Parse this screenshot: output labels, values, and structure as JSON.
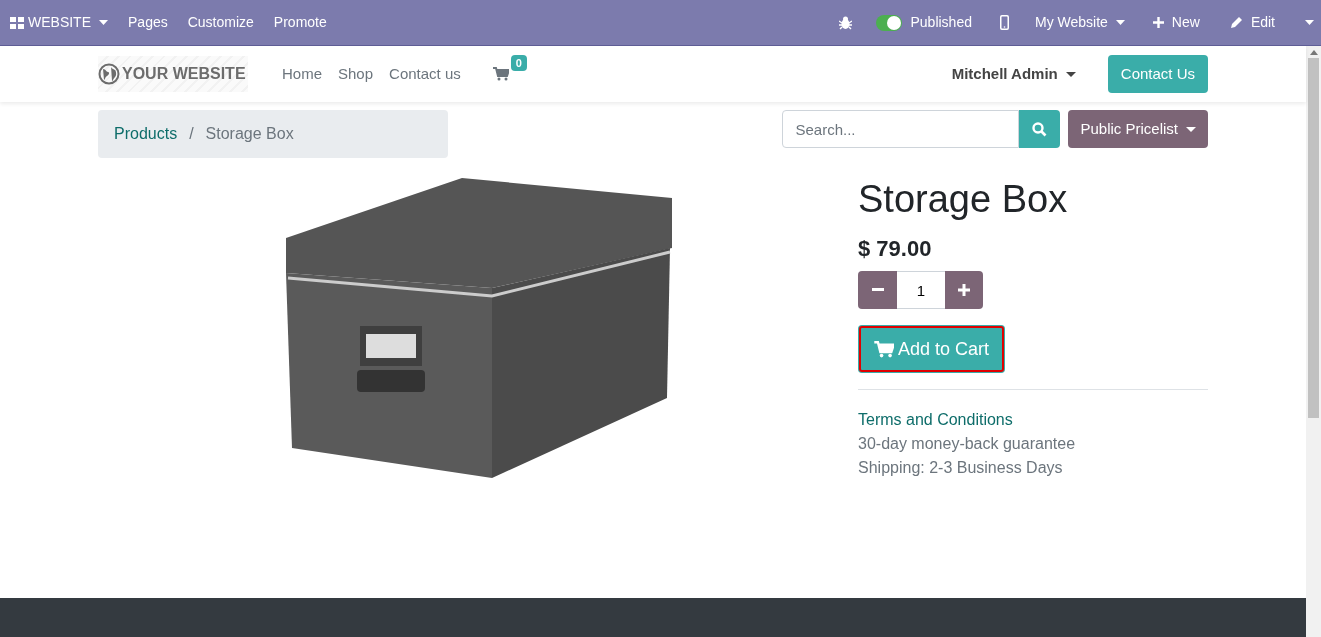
{
  "admin_bar": {
    "app_menu": "WEBSITE",
    "menu": [
      "Pages",
      "Customize",
      "Promote"
    ],
    "published": {
      "label": "Published",
      "on": true
    },
    "website_menu": "My Website",
    "new": "New",
    "edit": "Edit"
  },
  "header": {
    "logo": "YOUR WEBSITE",
    "nav": [
      {
        "label": "Home",
        "selected": false
      },
      {
        "label": "Shop",
        "selected": false
      },
      {
        "label": "Contact us",
        "selected": false
      }
    ],
    "cart_count": "0",
    "user": "Mitchell Admin",
    "contact_button": "Contact Us"
  },
  "breadcrumb": [
    "Products",
    "Storage Box"
  ],
  "breadcrumb_separator": "/",
  "search": {
    "placeholder": "Search..."
  },
  "pricelist": "Public Pricelist",
  "product": {
    "name": "Storage Box",
    "price": "$ 79.00",
    "quantity": "1",
    "add_to_cart": {
      "label": "Add to Cart",
      "highlighted": true
    },
    "terms": "Terms and Conditions",
    "info": [
      "30-day money-back guarantee",
      "Shipping: 2-3 Business Days"
    ]
  }
}
